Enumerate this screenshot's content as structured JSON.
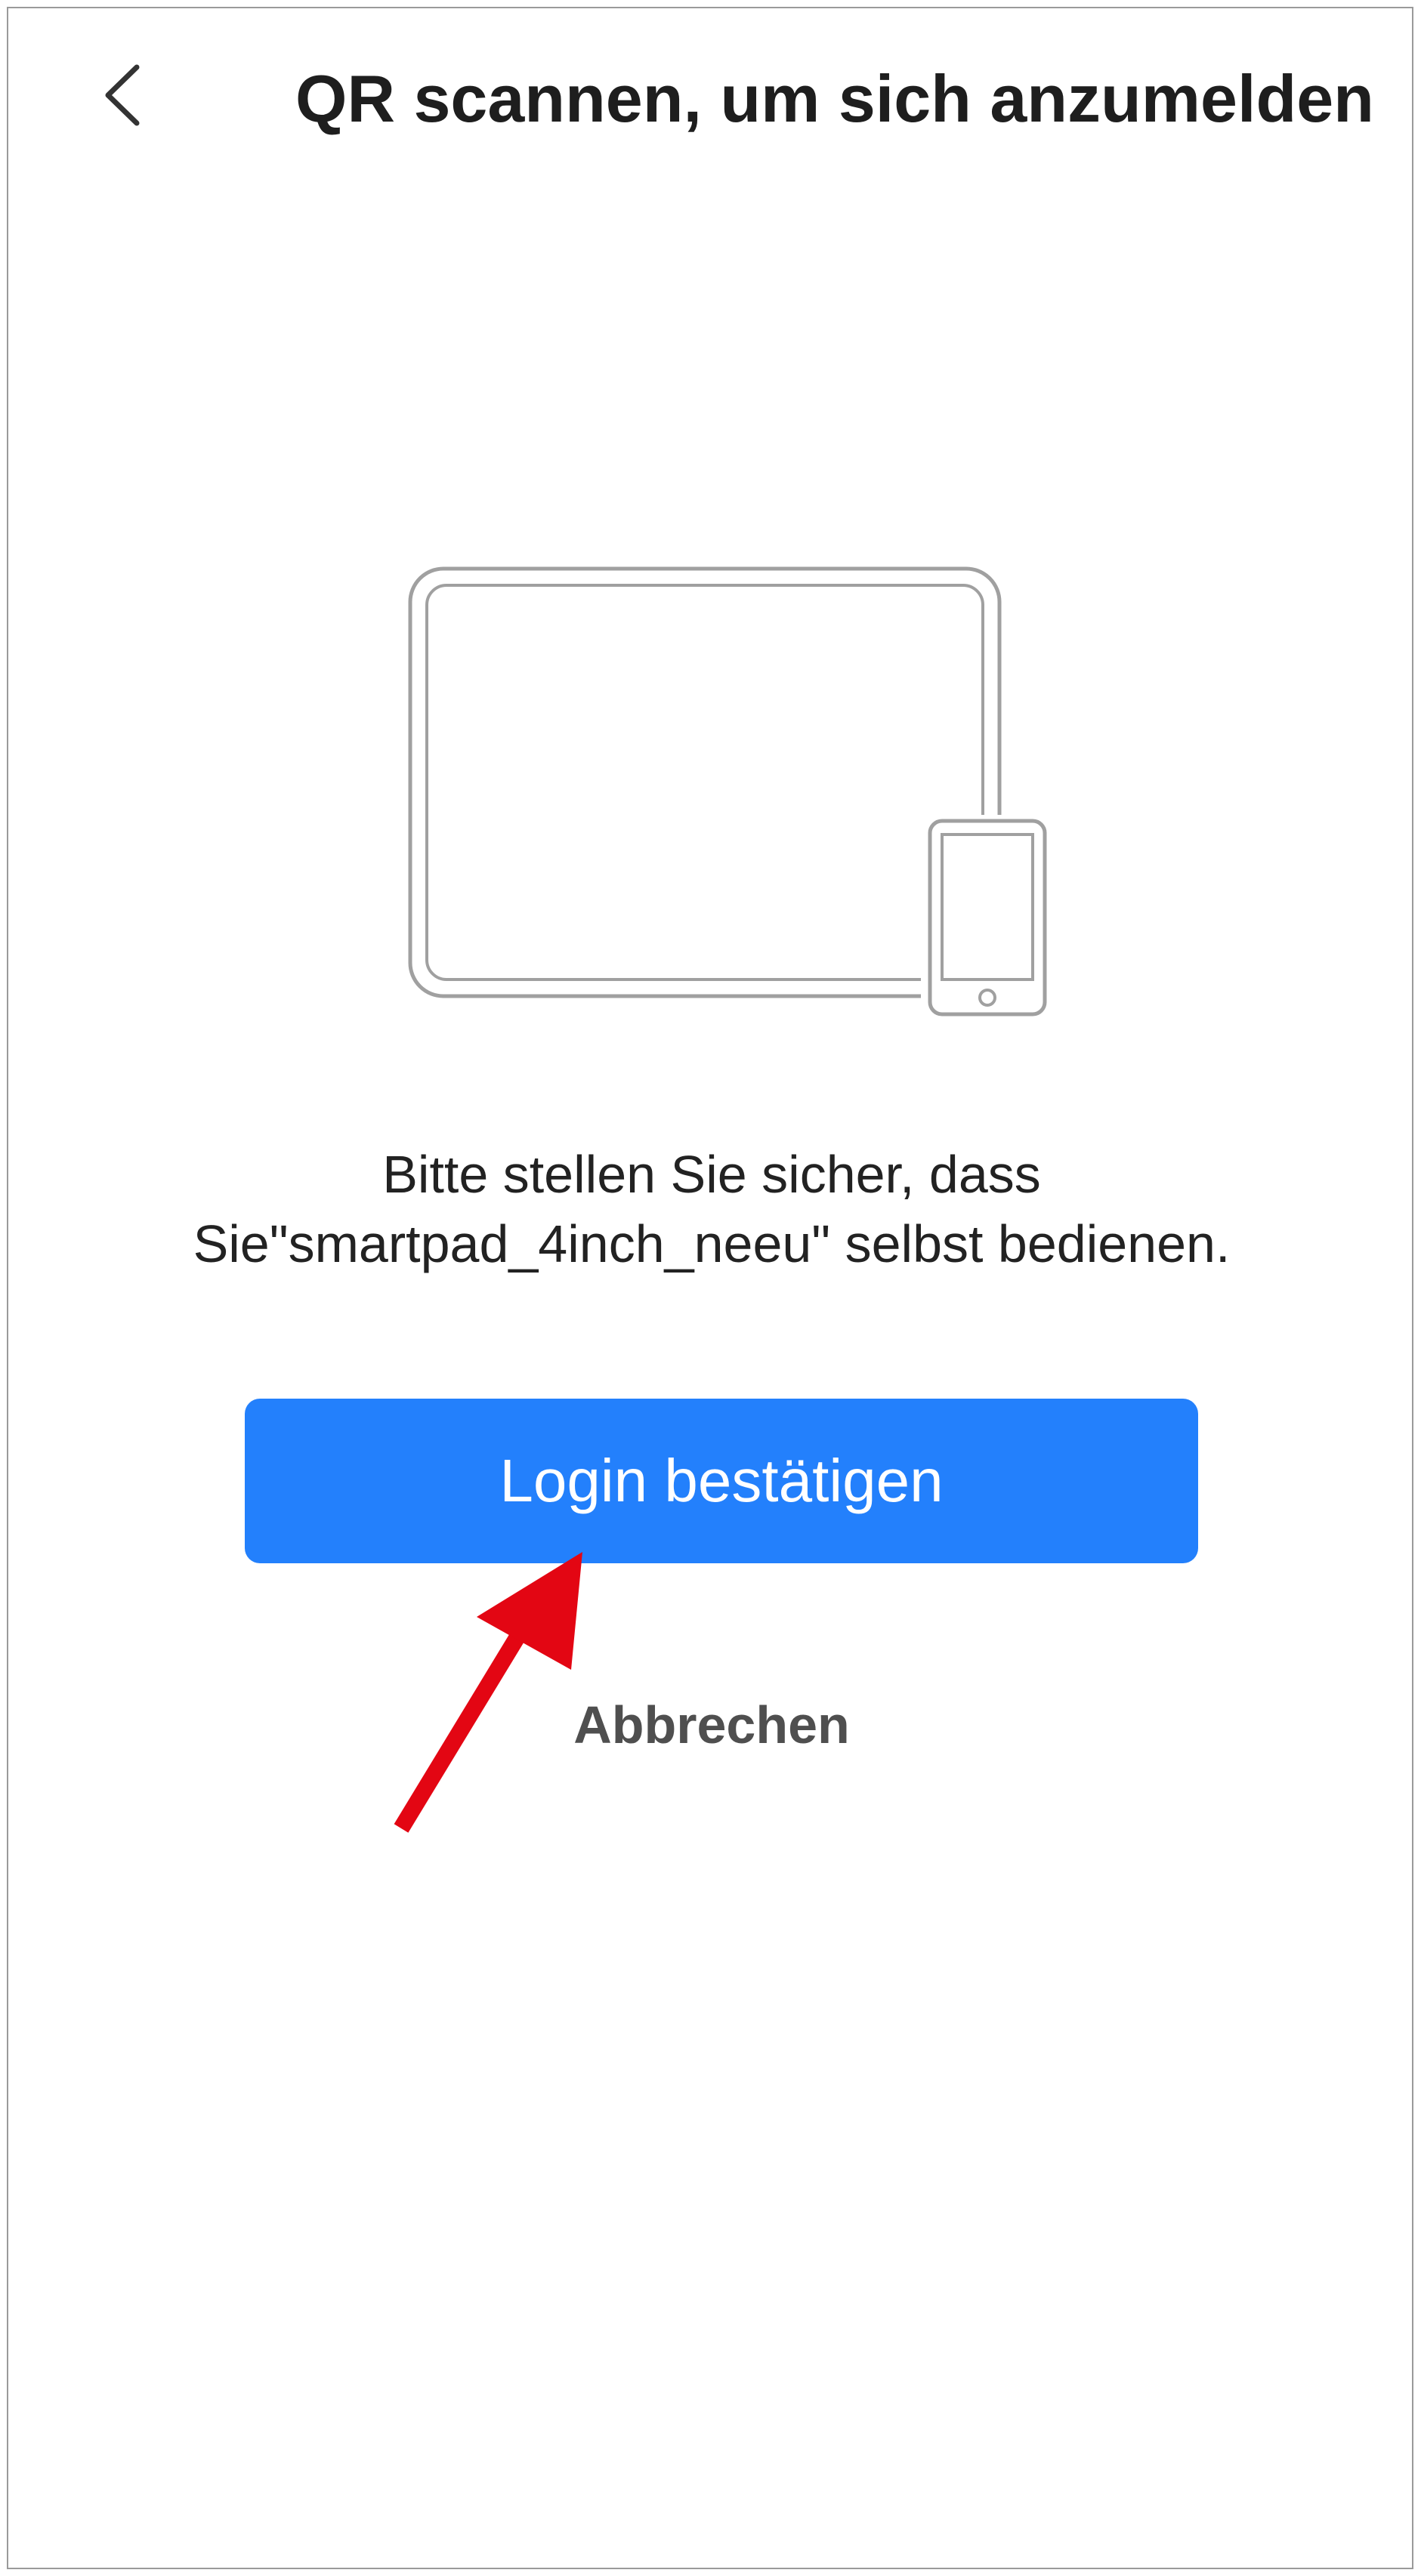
{
  "header": {
    "title": "QR scannen, um sich anzumelden",
    "back_icon": "chevron-left-icon"
  },
  "illustration": {
    "icon": "tablet-and-phone-icon"
  },
  "message": {
    "line1": "Bitte stellen Sie sicher, dass",
    "line2": "Sie\"smartpad_4inch_neeu\" selbst bedienen."
  },
  "actions": {
    "confirm_label": "Login bestätigen",
    "cancel_label": "Abbrechen"
  },
  "annotation": {
    "icon": "red-arrow-icon",
    "color": "#e30613"
  },
  "colors": {
    "primary_button": "#2380fc",
    "title_text": "#1e1e1e",
    "cancel_text": "#4f4f4f"
  }
}
